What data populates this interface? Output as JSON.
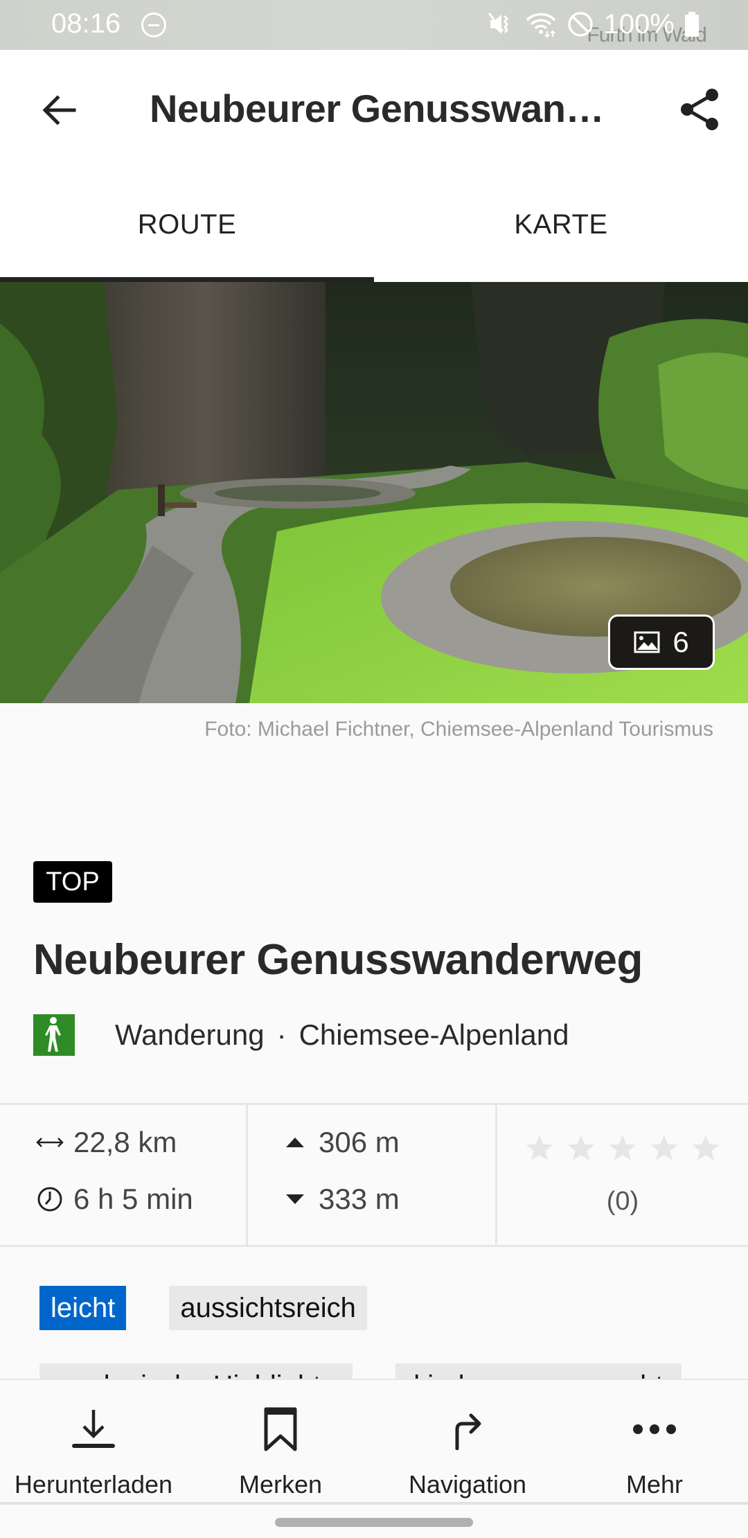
{
  "status_bar": {
    "time": "08:16",
    "battery": "100%",
    "icons": [
      "do-not-disturb-icon",
      "vibrate-mute-icon",
      "wifi-icon",
      "blocked-icon",
      "battery-icon"
    ],
    "map_text": "Furth im Wald"
  },
  "app_bar": {
    "title": "Neubeurer Genusswanderweg",
    "back_icon": "arrow-left-icon",
    "share_icon": "share-icon"
  },
  "tabs": [
    {
      "label": "ROUTE",
      "active": true
    },
    {
      "label": "KARTE",
      "active": false
    }
  ],
  "hero": {
    "image_count": "6",
    "gallery_icon": "image-icon",
    "credit": "Foto: Michael Fichtner, Chiemsee-Alpenland Tourismus"
  },
  "route": {
    "badge": "TOP",
    "title": "Neubeurer Genusswanderweg",
    "category": "Wanderung",
    "separator": "·",
    "region": "Chiemsee-Alpenland",
    "category_color": "#2e8b25"
  },
  "stats": {
    "distance": "22,8 km",
    "duration": "6 h 5 min",
    "ascent": "306 m",
    "descent": "333 m",
    "rating_stars": 0,
    "rating_max": 5,
    "rating_count": "(0)"
  },
  "tags": {
    "difficulty": {
      "label": "leicht",
      "color": "#0066cc"
    },
    "row1": [
      "aussichtsreich"
    ],
    "row2": [
      "geologische Highlights",
      "kinderwagengerecht"
    ]
  },
  "bottom_bar": [
    {
      "label": "Herunterladen",
      "icon": "download-icon"
    },
    {
      "label": "Merken",
      "icon": "bookmark-icon"
    },
    {
      "label": "Navigation",
      "icon": "turn-right-icon"
    },
    {
      "label": "Mehr",
      "icon": "more-horizontal-icon"
    }
  ]
}
